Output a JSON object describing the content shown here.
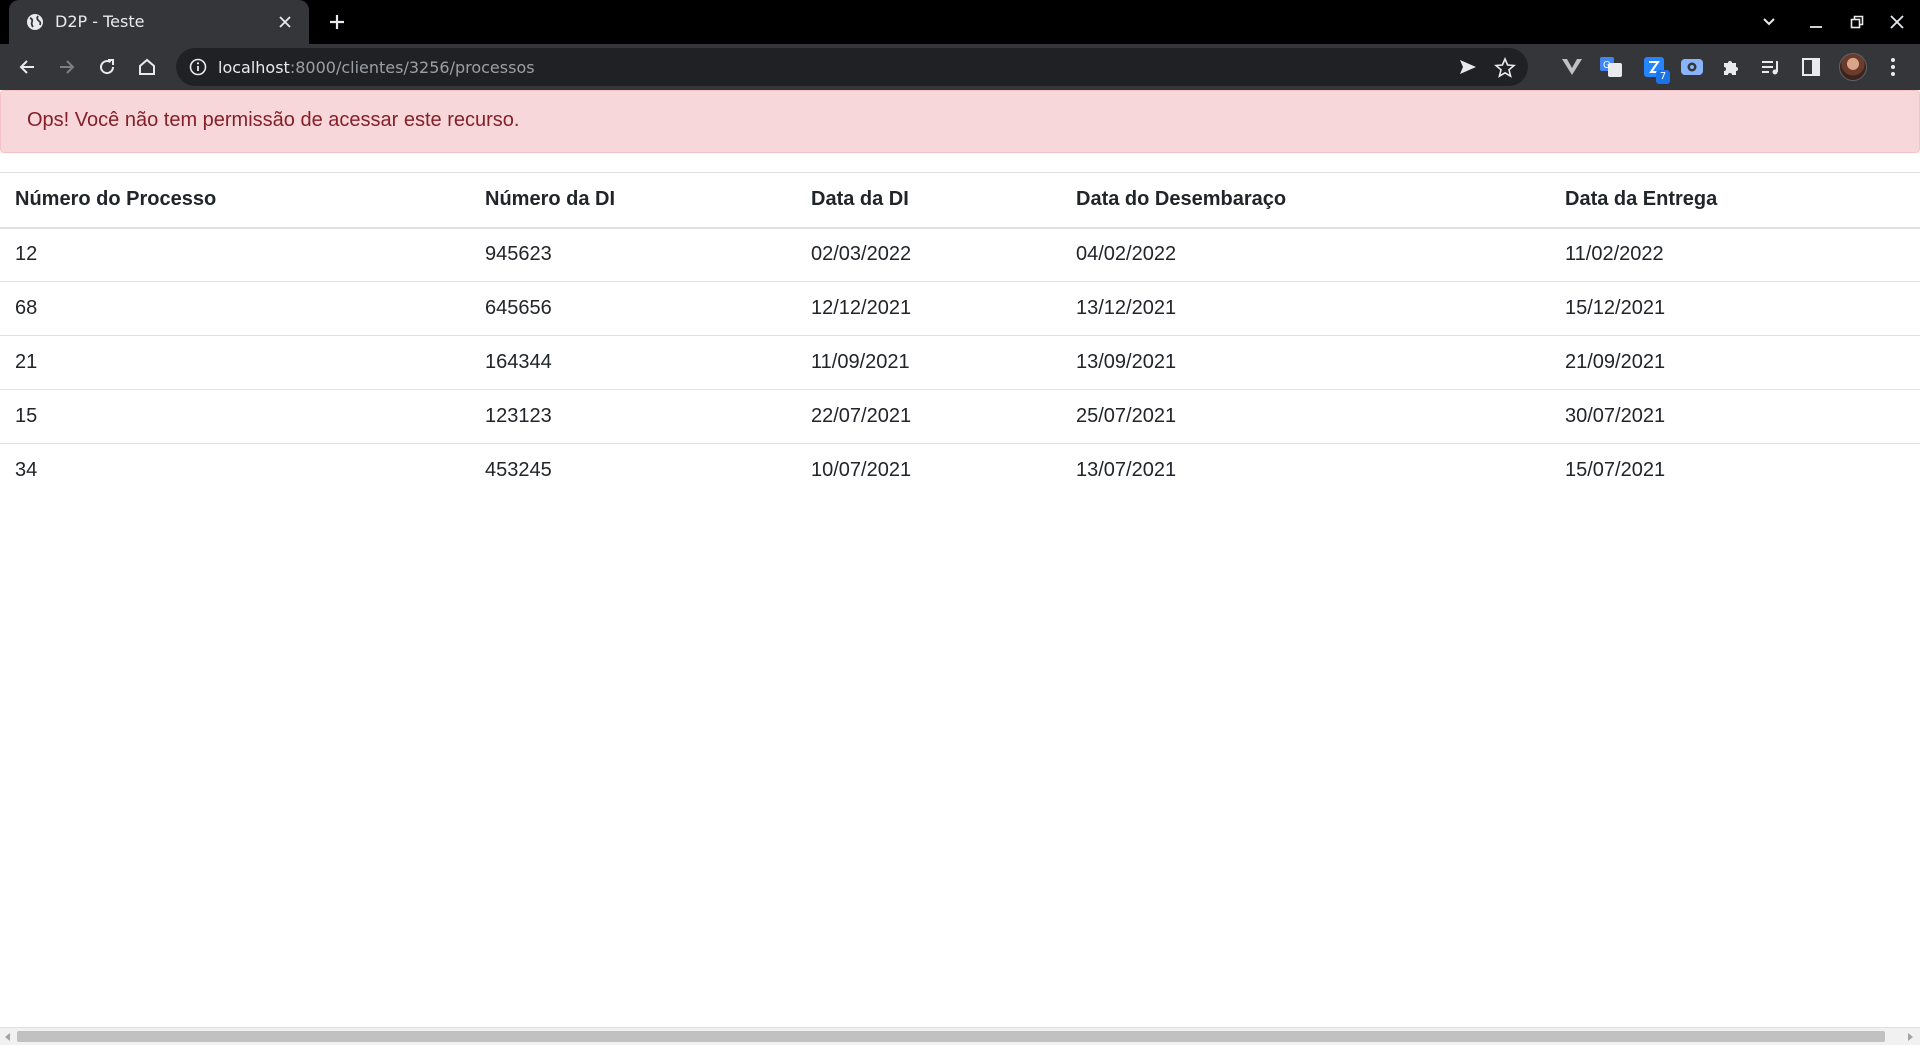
{
  "browser": {
    "tab": {
      "title": "D2P - Teste",
      "favicon": "globe-icon"
    },
    "address_bar": {
      "host": "localhost",
      "path": ":8000/clientes/3256/processos"
    },
    "extensions": [
      {
        "name": "vimium-icon"
      },
      {
        "name": "translate-icon"
      },
      {
        "name": "jira-icon",
        "badge": "7"
      },
      {
        "name": "screen-recorder-icon"
      },
      {
        "name": "extensions-puzzle-icon"
      },
      {
        "name": "media-playlist-icon"
      },
      {
        "name": "side-panel-icon"
      }
    ]
  },
  "alert": {
    "message": "Ops! Você não tem permissão de acessar este recurso.",
    "colors": {
      "background": "#f8d7da",
      "text": "#842029"
    }
  },
  "table": {
    "headers": [
      "Número do Processo",
      "Número da DI",
      "Data da DI",
      "Data do Desembaraço",
      "Data da Entrega"
    ],
    "rows": [
      [
        "12",
        "945623",
        "02/03/2022",
        "04/02/2022",
        "11/02/2022"
      ],
      [
        "68",
        "645656",
        "12/12/2021",
        "13/12/2021",
        "15/12/2021"
      ],
      [
        "21",
        "164344",
        "11/09/2021",
        "13/09/2021",
        "21/09/2021"
      ],
      [
        "15",
        "123123",
        "22/07/2021",
        "25/07/2021",
        "30/07/2021"
      ],
      [
        "34",
        "453245",
        "10/07/2021",
        "13/07/2021",
        "15/07/2021"
      ]
    ]
  }
}
